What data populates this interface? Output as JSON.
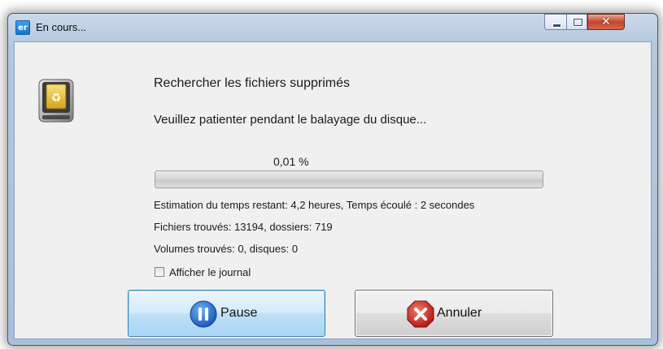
{
  "window": {
    "title": "En cours...",
    "app_icon_text": "er",
    "controls": {
      "minimize": "minimize",
      "maximize": "maximize",
      "close": "close"
    }
  },
  "content": {
    "heading": "Rechercher les fichiers supprimés",
    "subtext": "Veuillez patienter pendant le balayage du disque...",
    "progress_text": "0,01 %",
    "progress_fraction": 0.0001,
    "estimate": "Estimation du temps restant: 4,2 heures, Temps écoulé : 2 secondes",
    "files_found": "Fichiers trouvés: 13194, dossiers: 719",
    "volumes_found": "Volumes trouvés: 0, disques: 0",
    "show_log_label": "Afficher le journal",
    "show_log_checked": false
  },
  "buttons": {
    "pause_label": "Pause",
    "cancel_label": "Annuler"
  },
  "icons": {
    "drive": "recycle-drive-icon",
    "pause": "pause-icon",
    "cancel": "cancel-x-icon"
  },
  "colors": {
    "pause_blue": "#1f6fd1",
    "cancel_red": "#d0221b",
    "close_red": "#c7452c"
  }
}
